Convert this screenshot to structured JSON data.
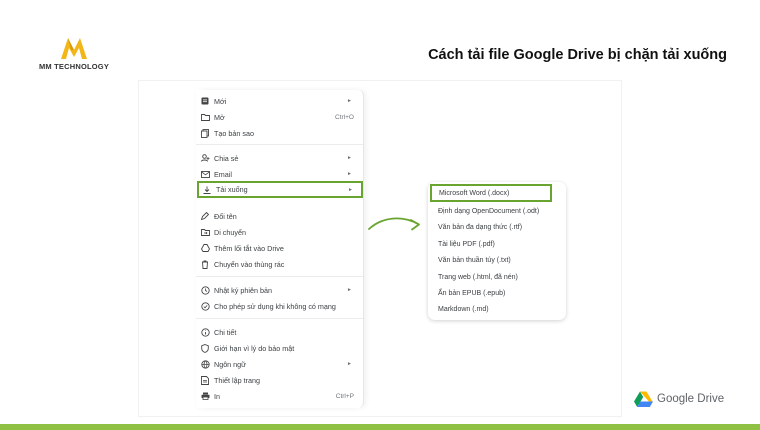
{
  "brand": {
    "name": "MM TECHNOLOGY",
    "logo_letter": "M",
    "logo_color": "#f2b619"
  },
  "headline": "Cách tải file Google Drive bị chặn tải xuống",
  "menu": {
    "items": [
      {
        "label": "Mới",
        "icon": "new-doc-icon",
        "shortcut": "",
        "submenu": true
      },
      {
        "label": "Mở",
        "icon": "folder-open-icon",
        "shortcut": "Ctrl+O",
        "submenu": false
      },
      {
        "label": "Tạo bản sao",
        "icon": "copy-icon",
        "shortcut": "",
        "submenu": false
      },
      {
        "label": "Chia sẻ",
        "icon": "share-person-icon",
        "shortcut": "",
        "submenu": true
      },
      {
        "label": "Email",
        "icon": "email-icon",
        "shortcut": "",
        "submenu": true
      },
      {
        "label": "Tải xuống",
        "icon": "download-icon",
        "shortcut": "",
        "submenu": true,
        "highlighted": true
      },
      {
        "label": "Đổi tên",
        "icon": "pencil-icon",
        "shortcut": "",
        "submenu": false
      },
      {
        "label": "Di chuyển",
        "icon": "move-folder-icon",
        "shortcut": "",
        "submenu": false
      },
      {
        "label": "Thêm lối tắt vào Drive",
        "icon": "drive-shortcut-icon",
        "shortcut": "",
        "submenu": false
      },
      {
        "label": "Chuyển vào thùng rác",
        "icon": "trash-icon",
        "shortcut": "",
        "submenu": false
      },
      {
        "label": "Nhật ký phiên bản",
        "icon": "history-icon",
        "shortcut": "",
        "submenu": true
      },
      {
        "label": "Cho phép sử dụng khi không có mạng",
        "icon": "offline-icon",
        "shortcut": "",
        "submenu": false
      },
      {
        "label": "Chi tiết",
        "icon": "info-icon",
        "shortcut": "",
        "submenu": false
      },
      {
        "label": "Giới hạn vì lý do bảo mật",
        "icon": "shield-icon",
        "shortcut": "",
        "submenu": false
      },
      {
        "label": "Ngôn ngữ",
        "icon": "globe-icon",
        "shortcut": "",
        "submenu": true
      },
      {
        "label": "Thiết lập trang",
        "icon": "page-setup-icon",
        "shortcut": "",
        "submenu": false
      },
      {
        "label": "In",
        "icon": "printer-icon",
        "shortcut": "Ctrl+P",
        "submenu": false
      }
    ]
  },
  "download_submenu": {
    "items": [
      {
        "label": "Microsoft Word (.docx)",
        "highlighted": true
      },
      {
        "label": "Định dạng OpenDocument (.odt)"
      },
      {
        "label": "Văn bản đa dạng thức (.rtf)"
      },
      {
        "label": "Tài liệu PDF (.pdf)"
      },
      {
        "label": "Văn bản thuần túy (.txt)"
      },
      {
        "label": "Trang web (.html, đã nén)"
      },
      {
        "label": "Ấn bản EPUB (.epub)"
      },
      {
        "label": "Markdown (.md)"
      }
    ]
  },
  "footer": {
    "google_drive_label": "Google Drive"
  },
  "colors": {
    "highlight": "#6aa430",
    "bottom_bar": "#8dc043"
  }
}
